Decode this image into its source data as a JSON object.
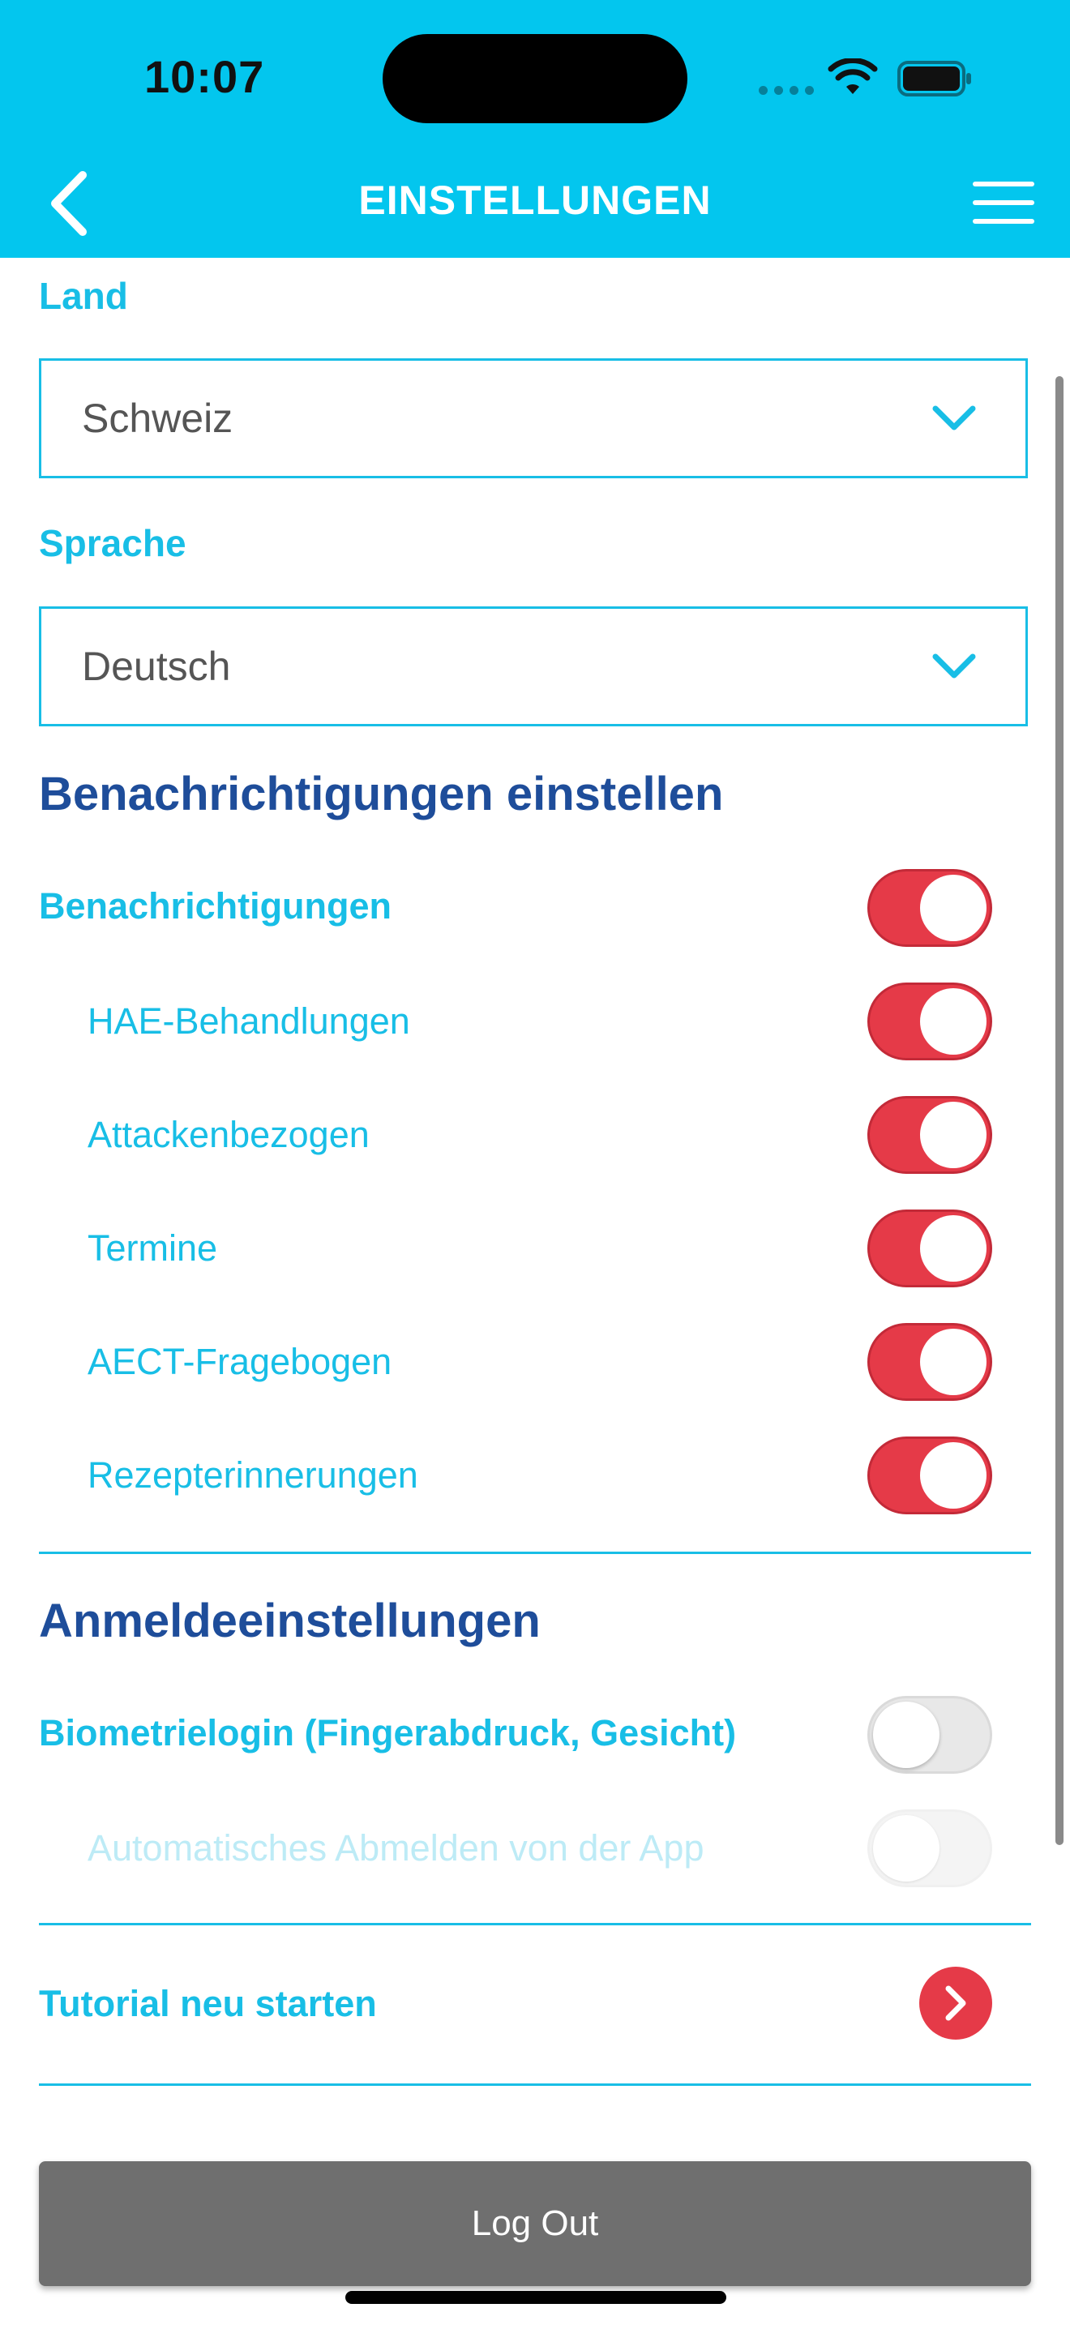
{
  "status_bar": {
    "time": "10:07"
  },
  "header": {
    "title": "EINSTELLUNGEN"
  },
  "land": {
    "label": "Land",
    "value": "Schweiz"
  },
  "sprache": {
    "label": "Sprache",
    "value": "Deutsch"
  },
  "notifications": {
    "title": "Benachrichtigungen einstellen",
    "main": {
      "label": "Benachrichtigungen",
      "on": true
    },
    "items": [
      {
        "label": "HAE-Behandlungen",
        "on": true
      },
      {
        "label": "Attackenbezogen",
        "on": true
      },
      {
        "label": "Termine",
        "on": true
      },
      {
        "label": "AECT-Fragebogen",
        "on": true
      },
      {
        "label": "Rezepterinnerungen",
        "on": true
      }
    ]
  },
  "login": {
    "title": "Anmeldeeinstellungen",
    "biometric": {
      "label": "Biometrielogin (Fingerabdruck, Gesicht)",
      "on": false
    },
    "auto_logout": {
      "label": "Automatisches Abmelden von der App",
      "on": false,
      "disabled": true
    }
  },
  "tutorial": {
    "label": "Tutorial neu starten"
  },
  "logout": {
    "label": "Log Out"
  },
  "colors": {
    "header": "#03C6EE",
    "accent": "#18BEE6",
    "heading": "#1E4D9A",
    "toggle_on": "#E53A48",
    "logout": "#6F6F6F"
  }
}
